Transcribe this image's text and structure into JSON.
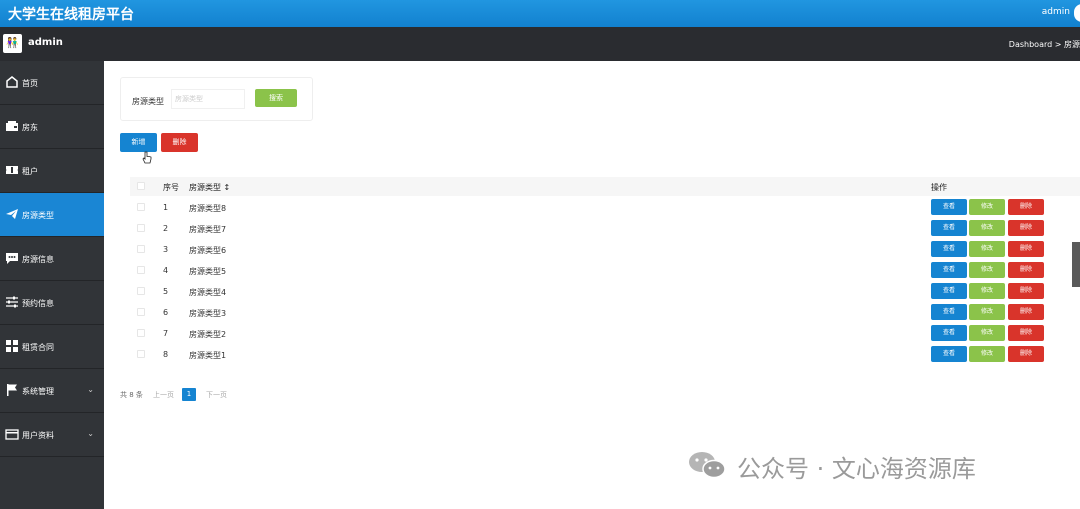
{
  "app_title": "大学生在线租房平台",
  "top_user": "admin",
  "sub_user": "admin",
  "breadcrumb": "Dashboard > 房源",
  "sidebar": {
    "items": [
      {
        "label": "首页",
        "icon": "home-icon"
      },
      {
        "label": "房东",
        "icon": "wallet-icon"
      },
      {
        "label": "租户",
        "icon": "ticket-icon"
      },
      {
        "label": "房源类型",
        "icon": "paper-plane-icon"
      },
      {
        "label": "房源信息",
        "icon": "chat-icon"
      },
      {
        "label": "预约信息",
        "icon": "sliders-icon"
      },
      {
        "label": "租赁合同",
        "icon": "grid-icon"
      },
      {
        "label": "系统管理",
        "icon": "flag-icon"
      },
      {
        "label": "用户资料",
        "icon": "card-icon"
      }
    ]
  },
  "search": {
    "label": "房源类型",
    "placeholder": "房源类型",
    "button": "搜索"
  },
  "actions": {
    "add": "新增",
    "delete": "删除"
  },
  "table": {
    "headers": {
      "index": "序号",
      "type": "房源类型 ↕",
      "ops": "操作"
    },
    "rows": [
      {
        "index": "1",
        "type": "房源类型8"
      },
      {
        "index": "2",
        "type": "房源类型7"
      },
      {
        "index": "3",
        "type": "房源类型6"
      },
      {
        "index": "4",
        "type": "房源类型5"
      },
      {
        "index": "5",
        "type": "房源类型4"
      },
      {
        "index": "6",
        "type": "房源类型3"
      },
      {
        "index": "7",
        "type": "房源类型2"
      },
      {
        "index": "8",
        "type": "房源类型1"
      }
    ],
    "row_actions": {
      "view": "查看",
      "edit": "修改",
      "delete": "删除"
    }
  },
  "pagination": {
    "total": "共 8 条",
    "prev": "上一页",
    "current": "1",
    "next": "下一页"
  },
  "watermark": "公众号 · 文心海资源库",
  "colors": {
    "primary": "#1584d1",
    "success": "#8bc34a",
    "danger": "#d9342b",
    "sidebar": "#313438"
  }
}
